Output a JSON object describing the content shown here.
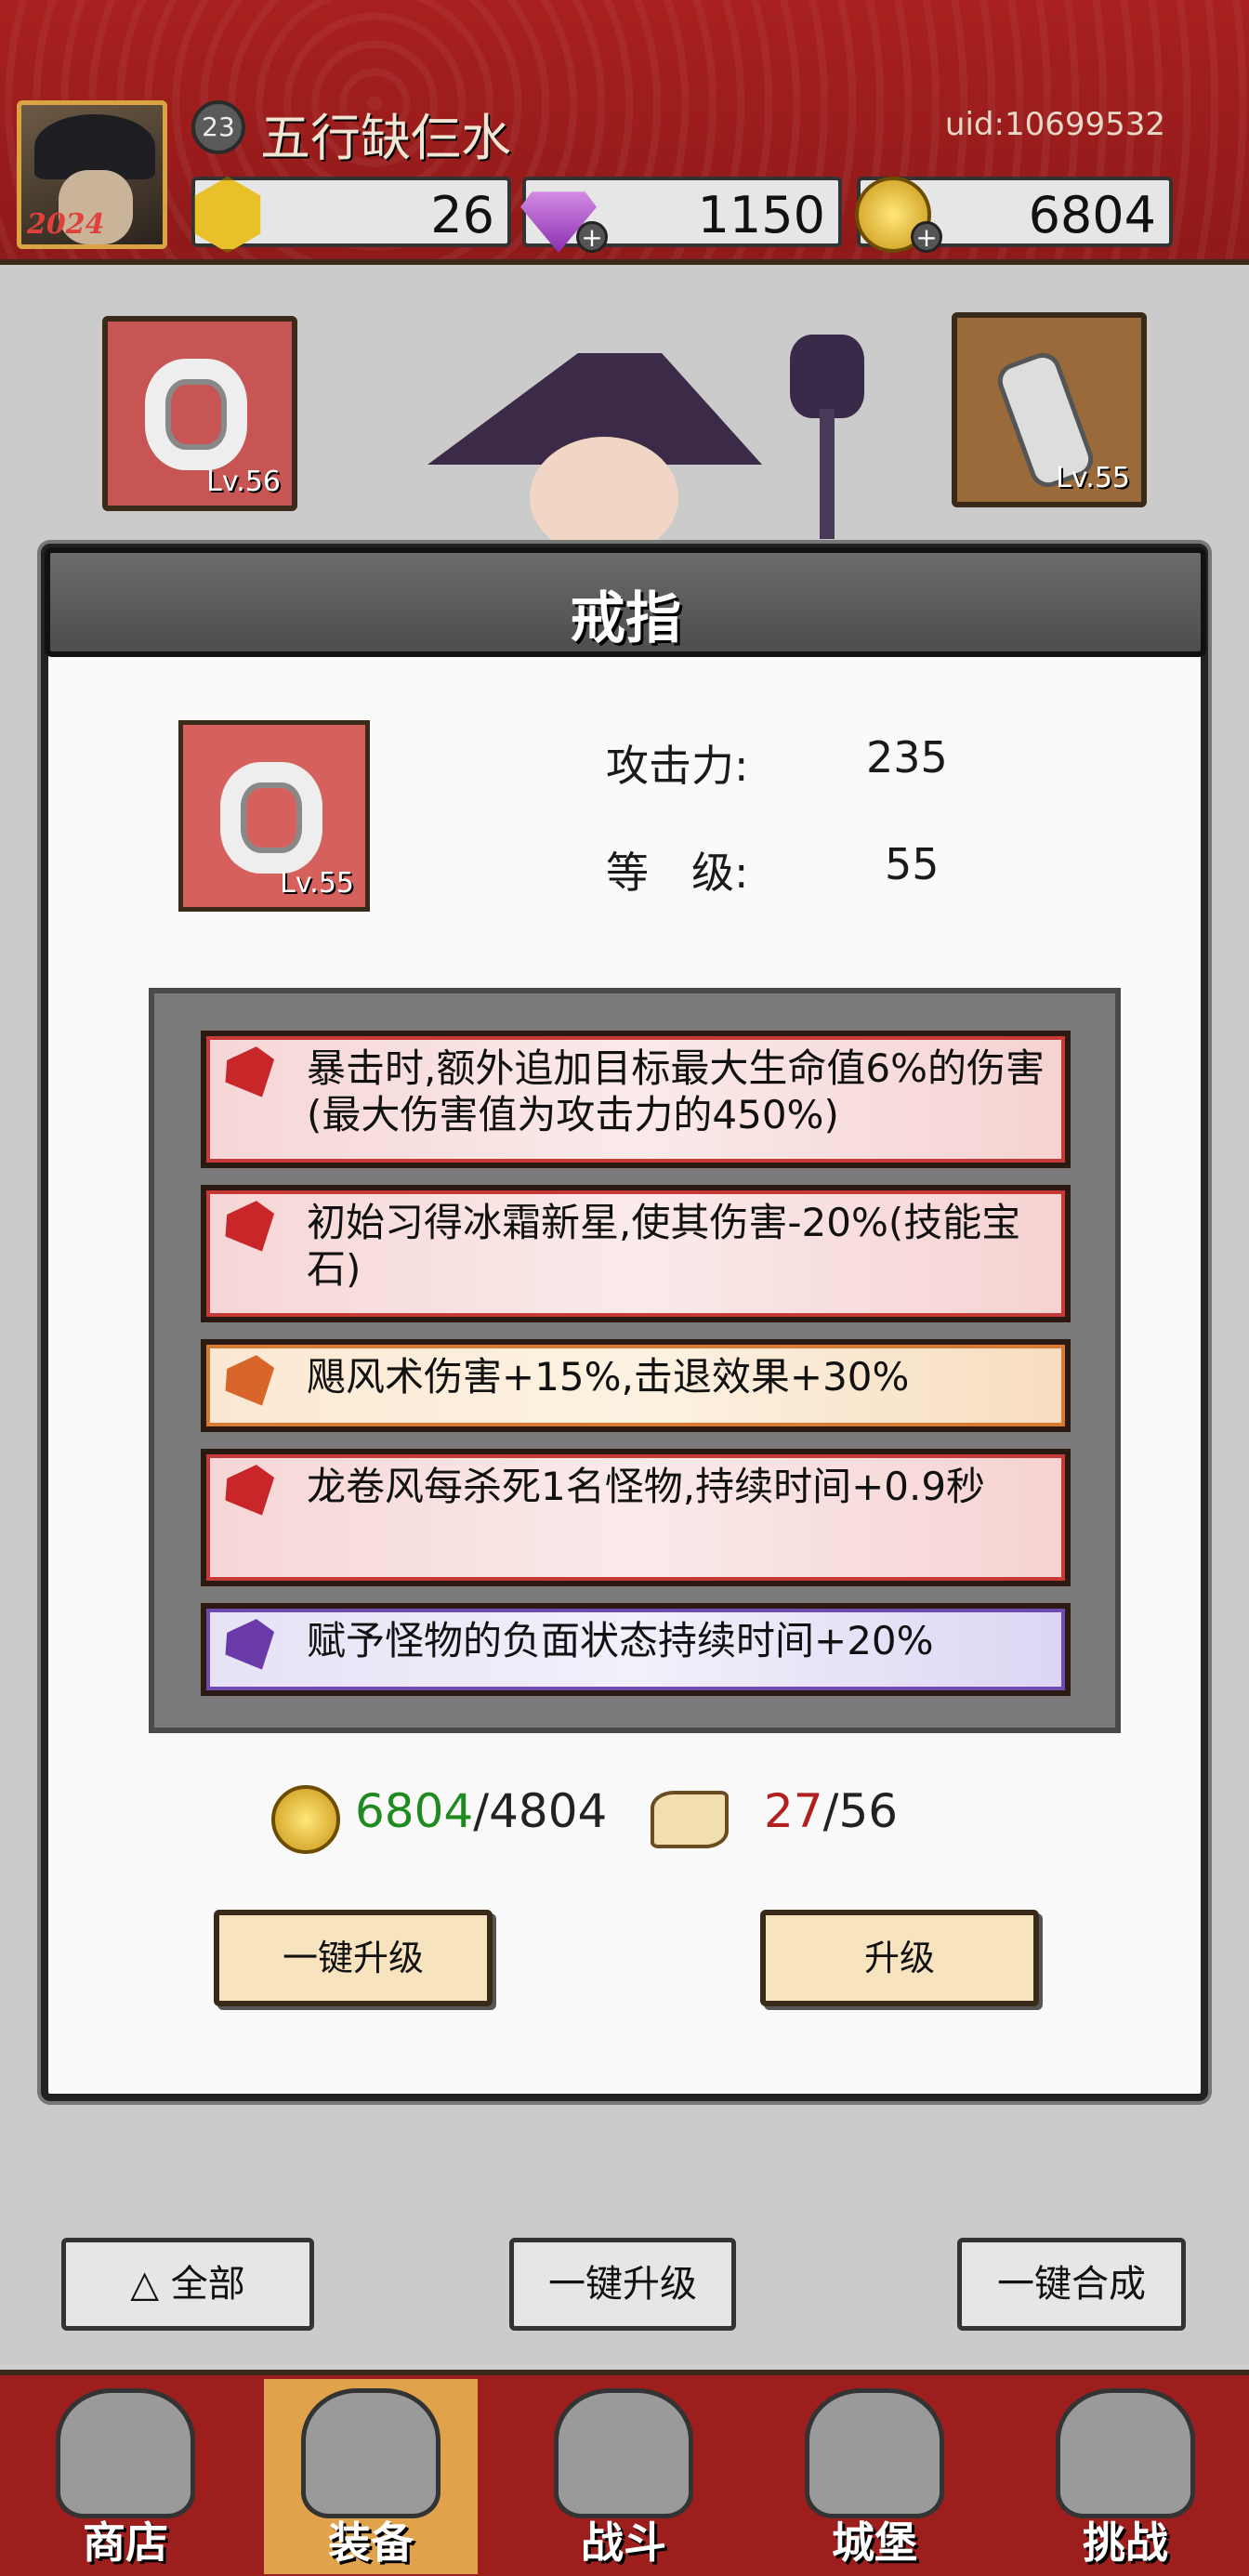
{
  "player": {
    "level": "23",
    "name": "五行缺仨水",
    "uid": "uid:10699532",
    "avatar_year": "2024"
  },
  "resources": {
    "energy": "26",
    "gems": "1150",
    "coins": "6804"
  },
  "equipped": {
    "left_level": "Lv.56",
    "right_level": "Lv.55"
  },
  "modal": {
    "title": "戒指",
    "item_level": "Lv.55",
    "attack_label": "攻击力:",
    "attack_value": "235",
    "level_label": "等　级:",
    "level_value": "55",
    "affixes": [
      {
        "text": "暴击时,额外追加目标最大生命值6%的伤害(最大伤害值为攻击力的450%)",
        "rarity": "red"
      },
      {
        "text": "初始习得冰霜新星,使其伤害-20%(技能宝石)",
        "rarity": "red"
      },
      {
        "text": "飓风术伤害+15%,击退效果+30%",
        "rarity": "orange"
      },
      {
        "text": "龙卷风每杀死1名怪物,持续时间+0.9秒",
        "rarity": "red"
      },
      {
        "text": "赋予怪物的负面状态持续时间+20%",
        "rarity": "purple"
      }
    ],
    "coin_have": "6804",
    "coin_need": "/4804",
    "scroll_have": "27",
    "scroll_need": "/56",
    "btn_one_key": "一键升级",
    "btn_upgrade": "升级"
  },
  "bottom_actions": {
    "filter": "全部",
    "one_key_upgrade": "一键升级",
    "one_key_merge": "一键合成"
  },
  "tabs": [
    "商店",
    "装备",
    "战斗",
    "城堡",
    "挑战"
  ],
  "colors": {
    "red_affix": "#c9262a",
    "orange_affix": "#d8652a",
    "purple_affix": "#6a3aa8",
    "coin_ok": "#1f8a1f",
    "scroll_short": "#b21f1f"
  }
}
